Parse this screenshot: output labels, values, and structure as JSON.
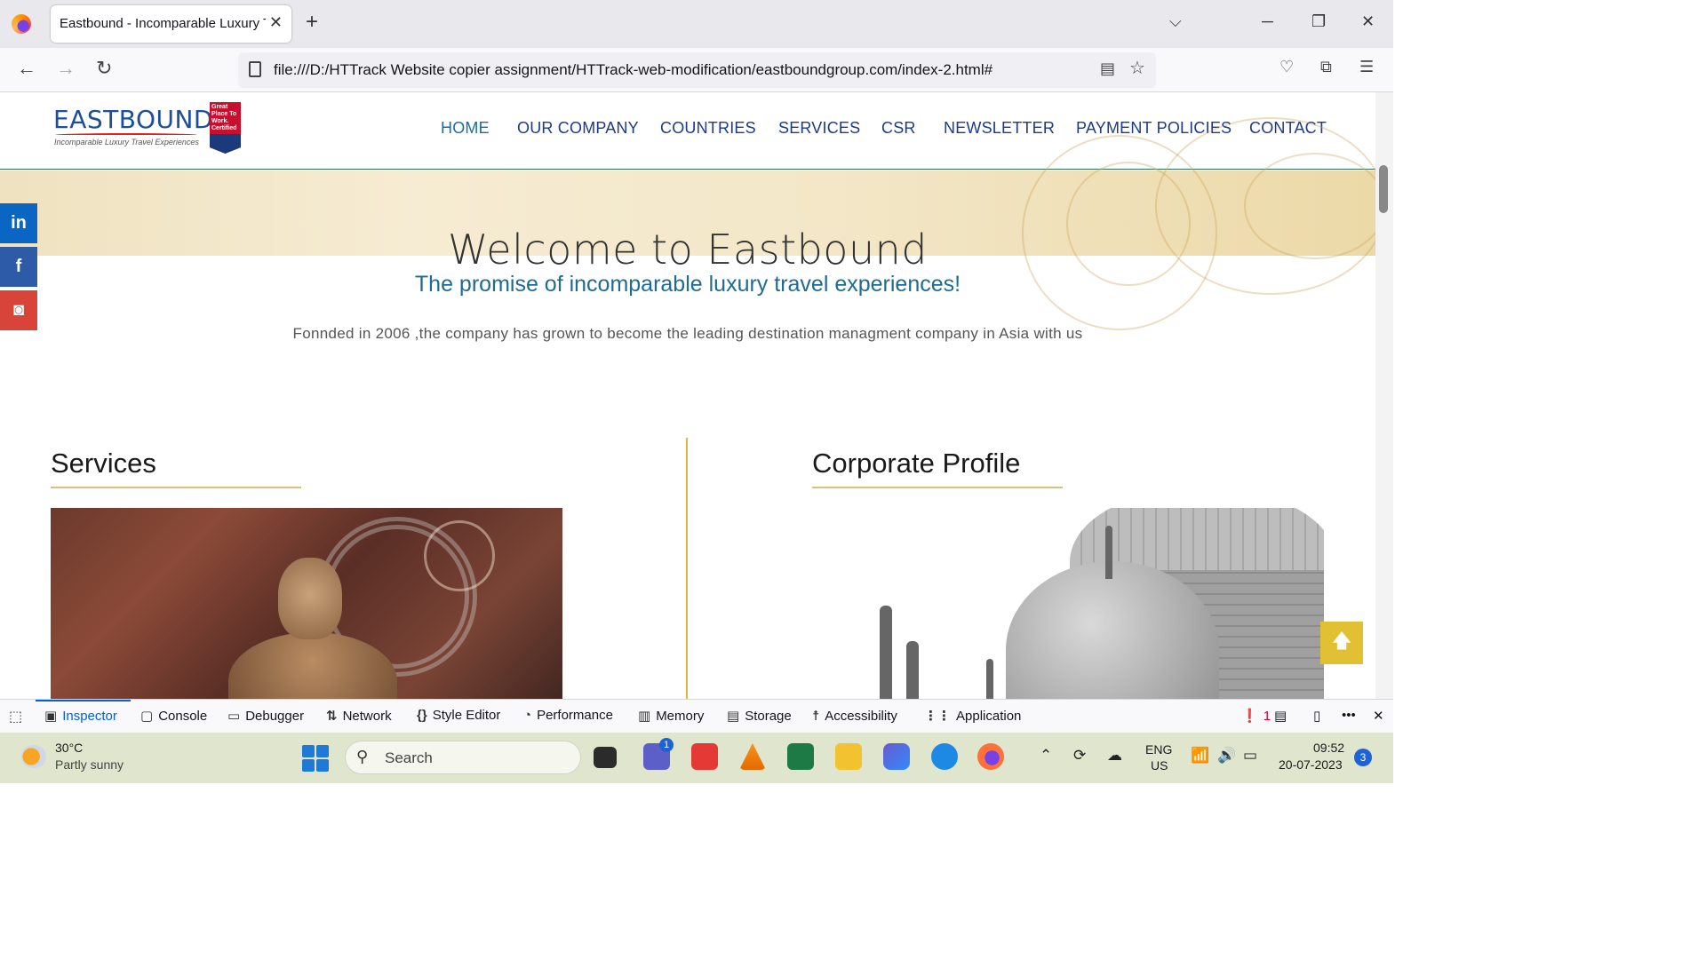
{
  "browser": {
    "tab_title": "Eastbound - Incomparable Luxury Tr",
    "url": "file:///D:/HTTrack Website copier assignment/HTTrack-web-modification/eastboundgroup.com/index-2.html#"
  },
  "site": {
    "logo_text": "EASTBOUND",
    "logo_tagline": "Incomparable Luxury Travel Experiences",
    "badge_text": "Great Place To Work. Certified",
    "nav": [
      "HOME",
      "OUR COMPANY",
      "COUNTRIES",
      "SERVICES",
      "CSR",
      "NEWSLETTER",
      "PAYMENT POLICIES",
      "CONTACT"
    ],
    "welcome": "Welcome to Eastbound",
    "promise": "The promise of incomparable luxury travel experiences!",
    "founded": "Fonnded in 2006 ,the company has grown to become the leading destination managment company in Asia with us",
    "services_title": "Services",
    "corporate_title": "Corporate Profile",
    "social": {
      "linkedin": "in",
      "facebook": "f",
      "instagram": "◙"
    },
    "colors": {
      "nav": "#1d3a8a",
      "promise": "#1e6b96",
      "accent": "#e2c034",
      "linkedin": "#0a66c2",
      "facebook": "#2d5ba8",
      "instagram": "#d9443a"
    }
  },
  "devtools": {
    "tabs": [
      "Inspector",
      "Console",
      "Debugger",
      "Network",
      "Style Editor",
      "Performance",
      "Memory",
      "Storage",
      "Accessibility",
      "Application"
    ],
    "error_count": "1"
  },
  "taskbar": {
    "temperature": "30°C",
    "weather": "Partly sunny",
    "search_label": "Search",
    "teams_badge": "1",
    "lang_1": "ENG",
    "lang_2": "US",
    "time": "09:52",
    "date": "20-07-2023",
    "notifications": "3"
  }
}
